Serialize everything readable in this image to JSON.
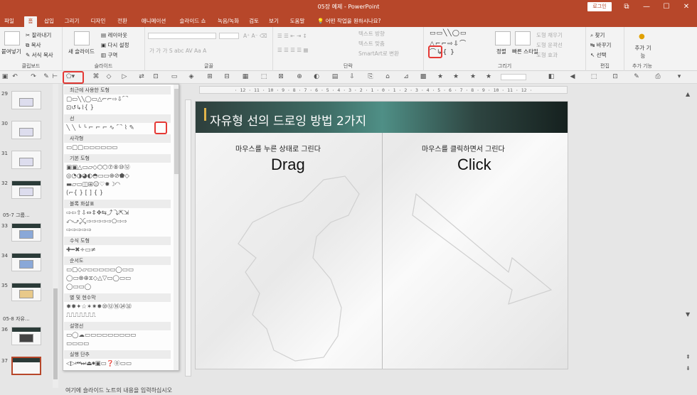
{
  "window": {
    "title": "05장 예제 - PowerPoint",
    "login_label": "로그인",
    "controls": [
      "⧉",
      "—",
      "☐",
      "✕"
    ]
  },
  "tabs": [
    {
      "label": "파일"
    },
    {
      "label": "홈"
    },
    {
      "label": "삽입"
    },
    {
      "label": "그리기"
    },
    {
      "label": "디자인"
    },
    {
      "label": "전환"
    },
    {
      "label": "애니메이션"
    },
    {
      "label": "슬라이드 쇼"
    },
    {
      "label": "녹음/녹화"
    },
    {
      "label": "검토"
    },
    {
      "label": "보기"
    },
    {
      "label": "도움말"
    }
  ],
  "tellme": "어떤 작업을 원하시나요?",
  "ribbon": {
    "clipboard": {
      "paste": "붙여넣기",
      "cut": "잘라내기",
      "copy": "복사",
      "format": "서식 복사",
      "label": "클립보드"
    },
    "slides": {
      "new_slide": "새 슬라이드",
      "layout": "레이아웃",
      "reset": "다시 설정",
      "section": "구역",
      "label": "슬라이드"
    },
    "font": {
      "label": "글꼴"
    },
    "paragraph": {
      "text_dir": "텍스트 방향",
      "text_align": "텍스트 맞춤",
      "smartart": "SmartArt로 변환",
      "label": "단락"
    },
    "drawing": {
      "arrange": "정렬",
      "quick_styles": "빠른 스타일",
      "fill": "도형 채우기",
      "outline": "도형 윤곽선",
      "effects": "도형 효과",
      "label": "그리기"
    },
    "editing": {
      "find": "찾기",
      "replace": "바꾸기",
      "select": "선택",
      "label": "편집"
    },
    "addin": {
      "btn": "추가 기능",
      "label": "추가 기능"
    }
  },
  "thumbnails": {
    "slides": [
      {
        "num": "29"
      },
      {
        "num": "30"
      },
      {
        "num": "31"
      },
      {
        "num": "32"
      },
      {
        "num": "33"
      },
      {
        "num": "34"
      },
      {
        "num": "35"
      },
      {
        "num": "36"
      },
      {
        "num": "37"
      }
    ],
    "sections": [
      "05-7 그룹...",
      "05-8 자유..."
    ]
  },
  "gallery": {
    "categories": [
      "최근에 사용한 도형",
      "선",
      "사각형",
      "기본 도형",
      "블록 화살표",
      "수식 도형",
      "순서도",
      "별 및 현수막",
      "설명선",
      "실행 단추"
    ],
    "rows": {
      "recent": [
        "▢▭╲╲◯▭△⌐⌐⇨⇩⌒",
        "⊡↺↳⌇{ }"
      ],
      "lines": [
        "╲ ╲ ╰ ╰ ⌐ ⌐ ⌐ ∿ ⌒ ⌇ ✎"
      ],
      "rect": [
        "▭▢▢▭▭▭▭▭▭"
      ],
      "basic": [
        "▣▣△▭▱◇⬡⬡⑦⑧⑩⑫",
        "◎◔◑◕◐◓▭▭⊕⊘⬟◇",
        "▬▱▭◫⊞☺♡✹☽◜◝",
        "(⌐{ } [ ] { }"
      ],
      "block": [
        "⇨⇦⇧⇩⇔⇕✥⇆⤴⤵⇱⇲",
        "⤺⤻⤸⤹⇨⇨⇨⇨⇨⬠⇨⇨",
        "⇨⇨⇨⇨⇨"
      ],
      "math": [
        "✚━✖÷▭≠"
      ],
      "flow": [
        "▭▢◇▱▭▭▭▭▭◯▭▭",
        "◯▭⊗⊕⧖◇△▽▭◯▭▭",
        "◯▭▭◯"
      ],
      "stars": [
        "✸✹✦☆✶✷✸⑩⑫⑯㉔㉜",
        "⎍⎍⎍⎍⎍⎍⎍"
      ],
      "callout": [
        "▭◯☁▭▭▭▭▭▭▭▭▭",
        "▭▭▭▭"
      ],
      "action": [
        "◁▷⏮⏭⏏⏺▣▭❓⓪▭▭"
      ]
    }
  },
  "slide": {
    "title": "자유형 선의 드로잉 방법 2가지",
    "left_caption": "마우스를 누른 상태로 그린다",
    "left_word": "Drag",
    "right_caption": "마우스를 클릭하면서 그린다",
    "right_word": "Click"
  },
  "ruler_text": "· 12 · 11 · 10 · 9 · 8 · 7 · 6 · 5 · 4 · 3 · 2 · 1 · 0 · 1 · 2 · 3 · 4 · 5 · 6 · 7 · 8 · 9 · 10 · 11 · 12 ·",
  "notes_text": "여기에 슬라이드 노트의 내용을 입력하십시오",
  "colors": {
    "brand": "#b7472a",
    "highlight": "#e53935"
  }
}
